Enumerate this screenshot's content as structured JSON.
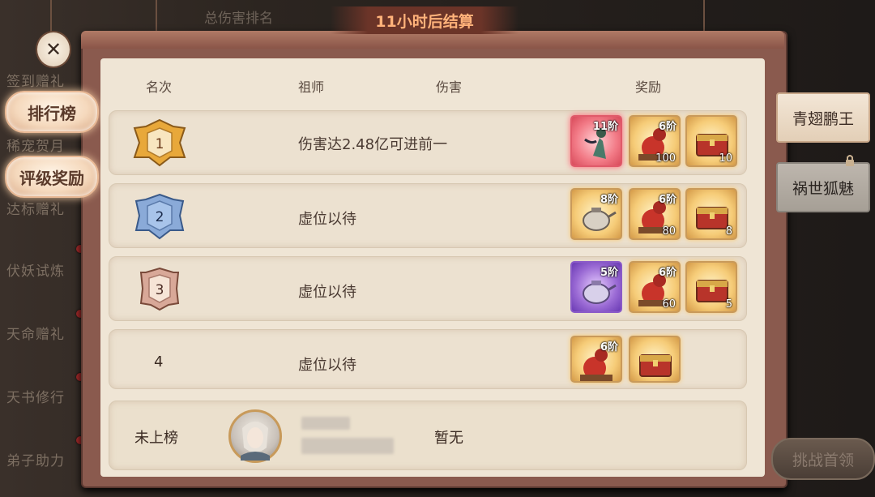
{
  "top": {
    "bg_label": "总伤害排名",
    "countdown": "11小时后结算"
  },
  "left_menu": {
    "items": [
      {
        "label": "签到赠礼"
      },
      {
        "label": "稀宠贺月"
      },
      {
        "label": "达标赠礼"
      },
      {
        "label": "伏妖试炼"
      },
      {
        "label": "天命赠礼"
      },
      {
        "label": "天书修行"
      },
      {
        "label": "弟子助力"
      }
    ],
    "tabs": [
      {
        "label": "排行榜"
      },
      {
        "label": "评级奖励"
      }
    ]
  },
  "headers": {
    "rank": "名次",
    "master": "祖师",
    "damage": "伤害",
    "reward": "奖励"
  },
  "rows": [
    {
      "rank": "1",
      "text": "伤害达2.48亿可进前一",
      "rewards": [
        {
          "tier": "11阶",
          "count": "",
          "style": "red",
          "icon": "figure-icon"
        },
        {
          "tier": "6阶",
          "count": "100",
          "style": "gold",
          "icon": "gourd-icon"
        },
        {
          "tier": "",
          "count": "10",
          "style": "gold",
          "icon": "chest-icon"
        }
      ]
    },
    {
      "rank": "2",
      "text": "虚位以待",
      "rewards": [
        {
          "tier": "8阶",
          "count": "",
          "style": "gold",
          "icon": "teapot-icon"
        },
        {
          "tier": "6阶",
          "count": "80",
          "style": "gold",
          "icon": "gourd-icon"
        },
        {
          "tier": "",
          "count": "8",
          "style": "gold",
          "icon": "chest-icon"
        }
      ]
    },
    {
      "rank": "3",
      "text": "虚位以待",
      "rewards": [
        {
          "tier": "5阶",
          "count": "",
          "style": "purple",
          "icon": "teapot-icon"
        },
        {
          "tier": "6阶",
          "count": "60",
          "style": "gold",
          "icon": "gourd-icon"
        },
        {
          "tier": "",
          "count": "5",
          "style": "gold",
          "icon": "chest-icon"
        }
      ]
    },
    {
      "rank": "4",
      "text": "虚位以待",
      "rewards": [
        {
          "tier": "6阶",
          "count": "",
          "style": "gold",
          "icon": "gourd-icon"
        },
        {
          "tier": "",
          "count": "",
          "style": "gold",
          "icon": "chest-icon"
        }
      ]
    }
  ],
  "self_row": {
    "rank": "未上榜",
    "damage": "暂无"
  },
  "right_tabs": [
    {
      "label": "青翅鹏王",
      "state": "active"
    },
    {
      "label": "祸世狐魅",
      "state": "locked"
    }
  ],
  "challenge_button": "挑战首领",
  "colors": {
    "title_text": "#ffb27a",
    "panel_bg": "#efe5d5",
    "frame": "#8a5a4e"
  }
}
